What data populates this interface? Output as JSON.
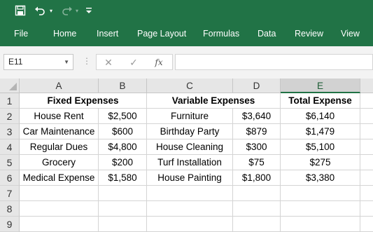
{
  "quick_access": {
    "save_icon": "save-icon",
    "undo_icon": "undo-icon",
    "redo_icon": "redo-icon",
    "dropdown_glyph": "▾"
  },
  "ribbon": {
    "tabs": [
      "File",
      "Home",
      "Insert",
      "Page Layout",
      "Formulas",
      "Data",
      "Review",
      "View"
    ]
  },
  "formula_bar": {
    "name_box": "E11",
    "formula": ""
  },
  "sheet": {
    "columns": [
      "A",
      "B",
      "C",
      "D",
      "E"
    ],
    "selected_column": "E",
    "row_numbers": [
      "1",
      "2",
      "3",
      "4",
      "5",
      "6",
      "7",
      "8",
      "9"
    ],
    "header_row": [
      "Fixed Expenses",
      "",
      "Variable Expenses",
      "",
      "Total Expense"
    ],
    "rows": [
      [
        "House Rent",
        "$2,500",
        "Furniture",
        "$3,640",
        "$6,140"
      ],
      [
        "Car Maintenance",
        "$600",
        "Birthday Party",
        "$879",
        "$1,479"
      ],
      [
        "Regular Dues",
        "$4,800",
        "House Cleaning",
        "$300",
        "$5,100"
      ],
      [
        "Grocery",
        "$200",
        "Turf Installation",
        "$75",
        "$275"
      ],
      [
        "Medical Expense",
        "$1,580",
        "House Painting",
        "$1,800",
        "$3,380"
      ]
    ]
  },
  "colors": {
    "brand_green": "#217346",
    "header_gray": "#e6e6e6"
  }
}
